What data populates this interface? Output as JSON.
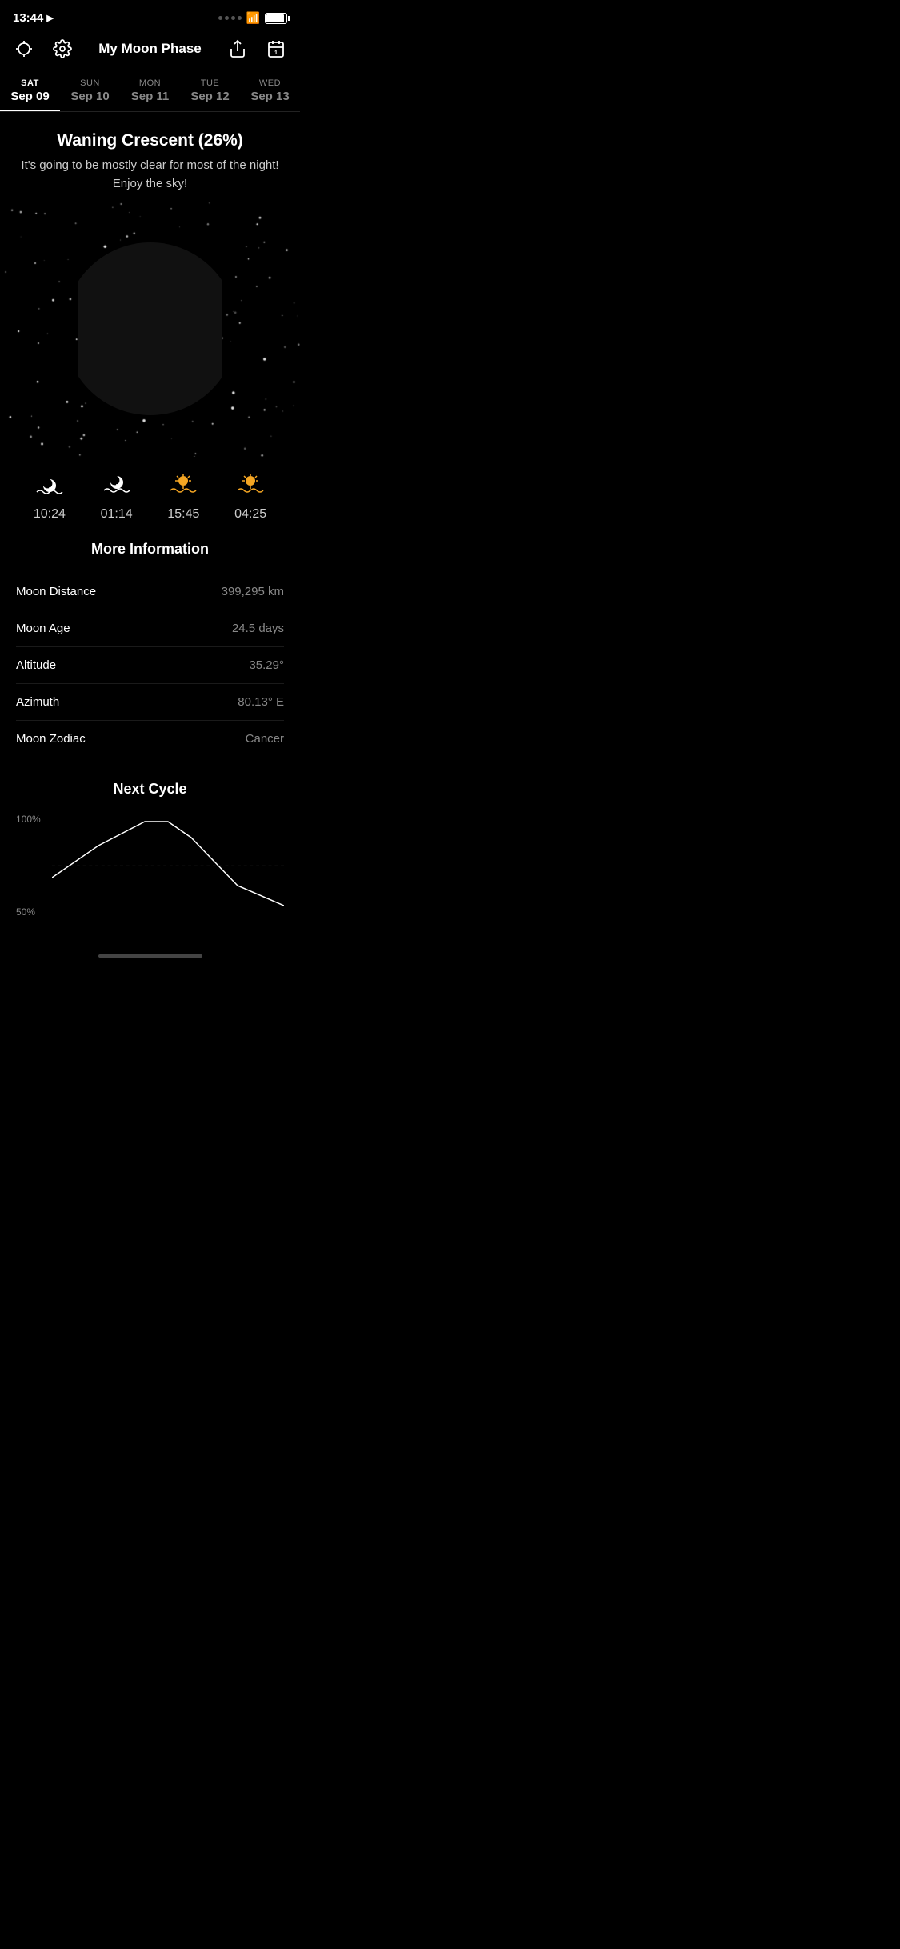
{
  "statusBar": {
    "time": "13:44",
    "locationIcon": "▶",
    "batteryLevel": 90
  },
  "header": {
    "title": "My Moon Phase",
    "crosshairIcon": "crosshair",
    "settingsIcon": "gear",
    "shareIcon": "share",
    "calendarIcon": "calendar",
    "calendarNumber": "1"
  },
  "days": [
    {
      "id": "sat-sep09",
      "name": "SAT",
      "date": "Sep 09",
      "active": true
    },
    {
      "id": "sun-sep10",
      "name": "SUN",
      "date": "Sep 10",
      "active": false
    },
    {
      "id": "mon-sep11",
      "name": "MON",
      "date": "Sep 11",
      "active": false
    },
    {
      "id": "tue-sep12",
      "name": "TUE",
      "date": "Sep 12",
      "active": false
    },
    {
      "id": "wed-sep13",
      "name": "WED",
      "date": "Sep 13",
      "active": false
    }
  ],
  "moonPhase": {
    "title": "Waning Crescent (26%)",
    "description": "It's going to be mostly clear for most of the night!\nEnjoy the sky!",
    "illumination": 26
  },
  "times": [
    {
      "id": "moon-rise",
      "icon": "moon-rise",
      "value": "10:24"
    },
    {
      "id": "moon-set",
      "icon": "moon-set",
      "value": "01:14"
    },
    {
      "id": "sun-set",
      "icon": "sun-set",
      "value": "15:45"
    },
    {
      "id": "sun-rise",
      "icon": "sun-rise",
      "value": "04:25"
    }
  ],
  "moreInfo": {
    "sectionTitle": "More Information",
    "rows": [
      {
        "label": "Moon Distance",
        "value": "399,295 km"
      },
      {
        "label": "Moon Age",
        "value": "24.5 days"
      },
      {
        "label": "Altitude",
        "value": "35.29°"
      },
      {
        "label": "Azimuth",
        "value": "80.13° E"
      },
      {
        "label": "Moon Zodiac",
        "value": "Cancer"
      }
    ]
  },
  "nextCycle": {
    "sectionTitle": "Next Cycle",
    "chartLabels": [
      "100%",
      "50%"
    ],
    "chartColor": "#ffffff"
  }
}
